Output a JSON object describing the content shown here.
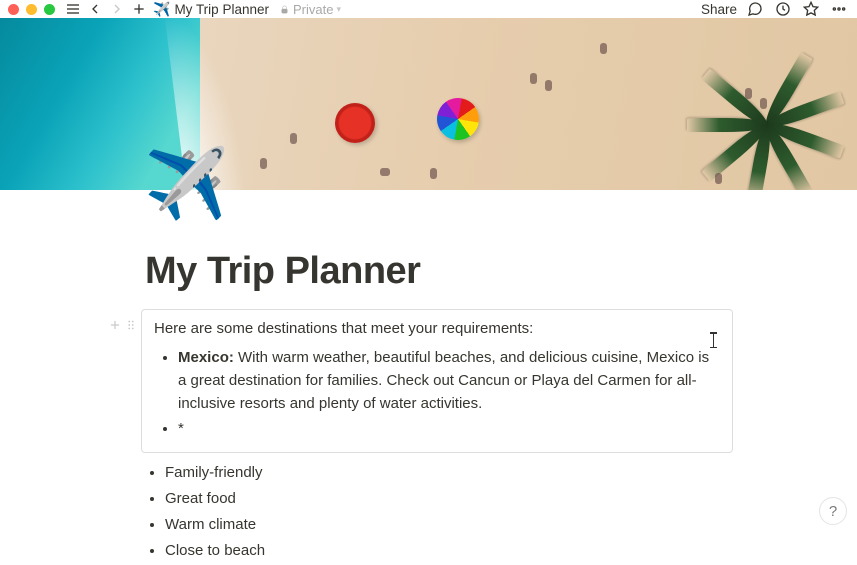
{
  "topbar": {
    "breadcrumb_emoji": "✈️",
    "breadcrumb_title": "My Trip Planner",
    "visibility_label": "Private",
    "share_label": "Share"
  },
  "page": {
    "emoji": "✈️",
    "title": "My Trip Planner"
  },
  "ai_block": {
    "intro": "Here are some destinations that meet your requirements:",
    "items": [
      {
        "bold": "Mexico:",
        "text": " With warm weather, beautiful beaches, and delicious cuisine, Mexico is a great destination for families. Check out Cancun or Playa del Carmen for all-inclusive resorts and plenty of water activities."
      },
      {
        "bold": "",
        "text": "*"
      }
    ]
  },
  "requirements": [
    "Family-friendly",
    "Great food",
    "Warm climate",
    "Close to beach"
  ],
  "help_label": "?"
}
